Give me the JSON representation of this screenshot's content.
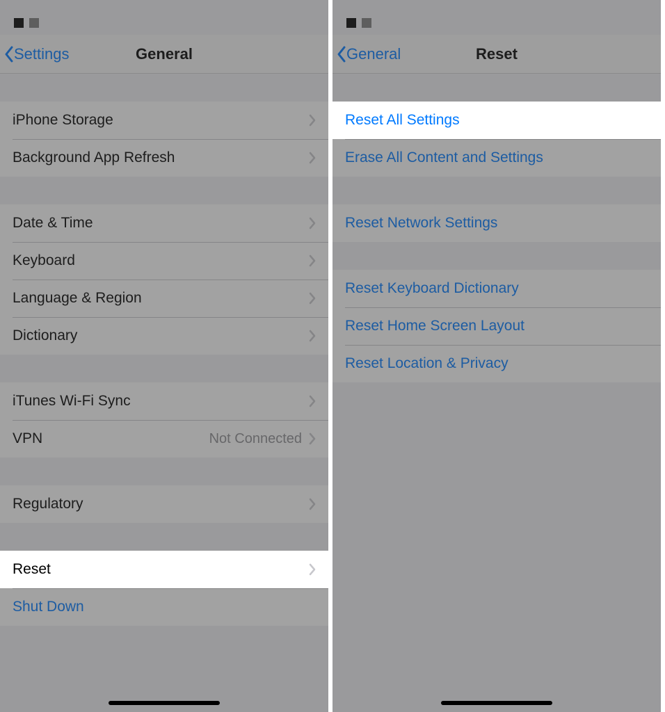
{
  "left": {
    "back_label": "Settings",
    "title": "General",
    "groups": [
      {
        "gap": "normal",
        "items": [
          {
            "label": "iPhone Storage",
            "chevron": true
          },
          {
            "label": "Background App Refresh",
            "chevron": true
          }
        ]
      },
      {
        "gap": "normal",
        "items": [
          {
            "label": "Date & Time",
            "chevron": true
          },
          {
            "label": "Keyboard",
            "chevron": true
          },
          {
            "label": "Language & Region",
            "chevron": true
          },
          {
            "label": "Dictionary",
            "chevron": true
          }
        ]
      },
      {
        "gap": "normal",
        "items": [
          {
            "label": "iTunes Wi-Fi Sync",
            "chevron": true
          },
          {
            "label": "VPN",
            "value": "Not Connected",
            "chevron": true
          }
        ]
      },
      {
        "gap": "normal",
        "items": [
          {
            "label": "Regulatory",
            "chevron": true
          }
        ]
      },
      {
        "gap": "normal",
        "items": [
          {
            "label": "Reset",
            "chevron": true,
            "highlight": true
          },
          {
            "label": "Shut Down",
            "blue": true,
            "chevron": false
          }
        ]
      }
    ]
  },
  "right": {
    "back_label": "General",
    "title": "Reset",
    "groups": [
      {
        "gap": "normal",
        "items": [
          {
            "label": "Reset All Settings",
            "blue": true,
            "chevron": false,
            "highlight": true
          },
          {
            "label": "Erase All Content and Settings",
            "blue": true,
            "chevron": false
          }
        ]
      },
      {
        "gap": "normal",
        "items": [
          {
            "label": "Reset Network Settings",
            "blue": true,
            "chevron": false
          }
        ]
      },
      {
        "gap": "normal",
        "items": [
          {
            "label": "Reset Keyboard Dictionary",
            "blue": true,
            "chevron": false
          },
          {
            "label": "Reset Home Screen Layout",
            "blue": true,
            "chevron": false
          },
          {
            "label": "Reset Location & Privacy",
            "blue": true,
            "chevron": false
          }
        ]
      }
    ]
  }
}
